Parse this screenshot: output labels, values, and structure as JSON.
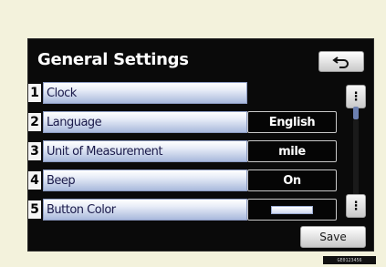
{
  "screen": {
    "title": "General Settings",
    "back_icon": "return-arrow-icon",
    "items": [
      {
        "number": "1",
        "label": "Clock",
        "value": null
      },
      {
        "number": "2",
        "label": "Language",
        "value": "English"
      },
      {
        "number": "3",
        "label": "Unit of Measurement",
        "value": "mile"
      },
      {
        "number": "4",
        "label": "Beep",
        "value": "On"
      },
      {
        "number": "5",
        "label": "Button Color",
        "value": null,
        "swatch": true
      }
    ],
    "scroll_up_icon": "scroll-up-icon",
    "scroll_down_icon": "scroll-down-icon",
    "save_label": "Save"
  },
  "footer_code": "GE0123456"
}
